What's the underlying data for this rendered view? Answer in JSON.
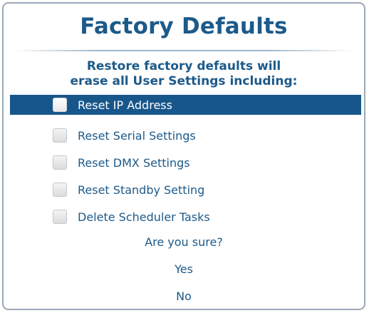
{
  "dialog": {
    "title": "Factory Defaults",
    "warning_line1": "Restore factory defaults will",
    "warning_line2": "erase all User Settings including:",
    "options": [
      {
        "label": "Reset IP Address",
        "checked": false,
        "highlighted": true
      },
      {
        "label": "Reset Serial Settings",
        "checked": false,
        "highlighted": false
      },
      {
        "label": "Reset DMX Settings",
        "checked": false,
        "highlighted": false
      },
      {
        "label": "Reset Standby Setting",
        "checked": false,
        "highlighted": false
      },
      {
        "label": "Delete Scheduler Tasks",
        "checked": false,
        "highlighted": false
      }
    ],
    "confirm_prompt": "Are you sure?",
    "yes_label": "Yes",
    "no_label": "No"
  },
  "colors": {
    "text": "#1c5a8a",
    "highlight": "#17568a",
    "border": "#9aa9b8"
  }
}
